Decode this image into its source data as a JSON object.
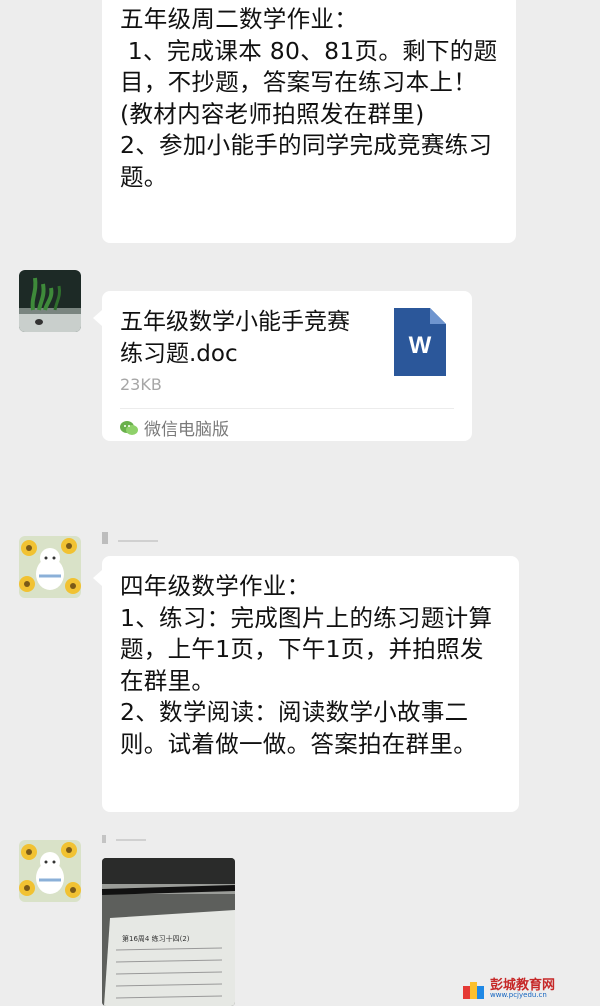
{
  "messages": {
    "m1": {
      "text": "五年级周二数学作业：\n 1、完成课本 80、81页。剩下的题目，不抄题，答案写在练习本上！(教材内容老师拍照发在群里)\n2、参加小能手的同学完成竞赛练习题。"
    },
    "m2": {
      "file_name": "五年级数学小能手竞赛练习题.doc",
      "file_size": "23KB",
      "file_icon_letter": "W",
      "source": "微信电脑版"
    },
    "m3": {
      "text": "四年级数学作业：\n1、练习：完成图片上的练习题计算题，上午1页，下午1页，并拍照发在群里。\n2、数学阅读：阅读数学小故事二则。试着做一做。答案拍在群里。"
    },
    "m4": {
      "photo_title": "第16周4  练习十四(2)"
    }
  },
  "watermark": {
    "name": "彭城教育网",
    "url": "www.pcjyedu.cn"
  },
  "colors": {
    "background": "#ededed",
    "bubble": "#ffffff",
    "word_icon": "#2b579a"
  }
}
